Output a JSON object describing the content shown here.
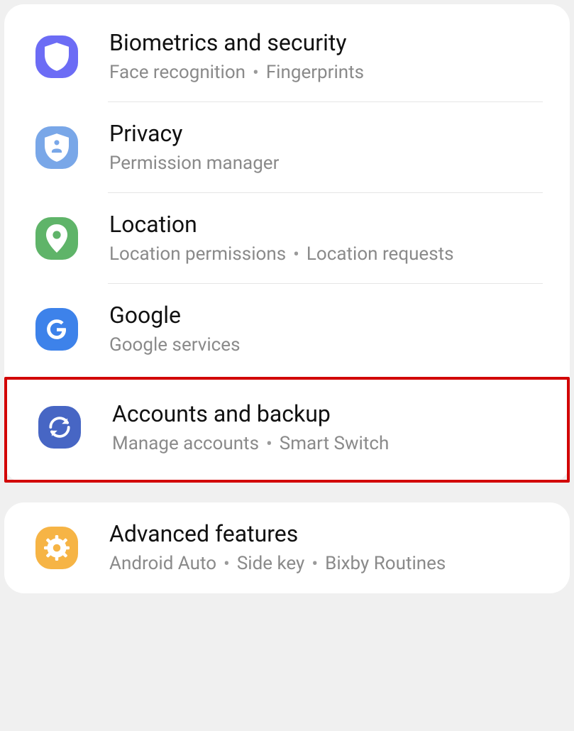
{
  "settings": {
    "biometrics": {
      "title": "Biometrics and security",
      "sub1": "Face recognition",
      "sub2": "Fingerprints"
    },
    "privacy": {
      "title": "Privacy",
      "sub1": "Permission manager"
    },
    "location": {
      "title": "Location",
      "sub1": "Location permissions",
      "sub2": "Location requests"
    },
    "google": {
      "title": "Google",
      "sub1": "Google services"
    },
    "accounts": {
      "title": "Accounts and backup",
      "sub1": "Manage accounts",
      "sub2": "Smart Switch"
    },
    "advanced": {
      "title": "Advanced features",
      "sub1": "Android Auto",
      "sub2": "Side key",
      "sub3": "Bixby Routines"
    }
  },
  "highlighted": "accounts"
}
